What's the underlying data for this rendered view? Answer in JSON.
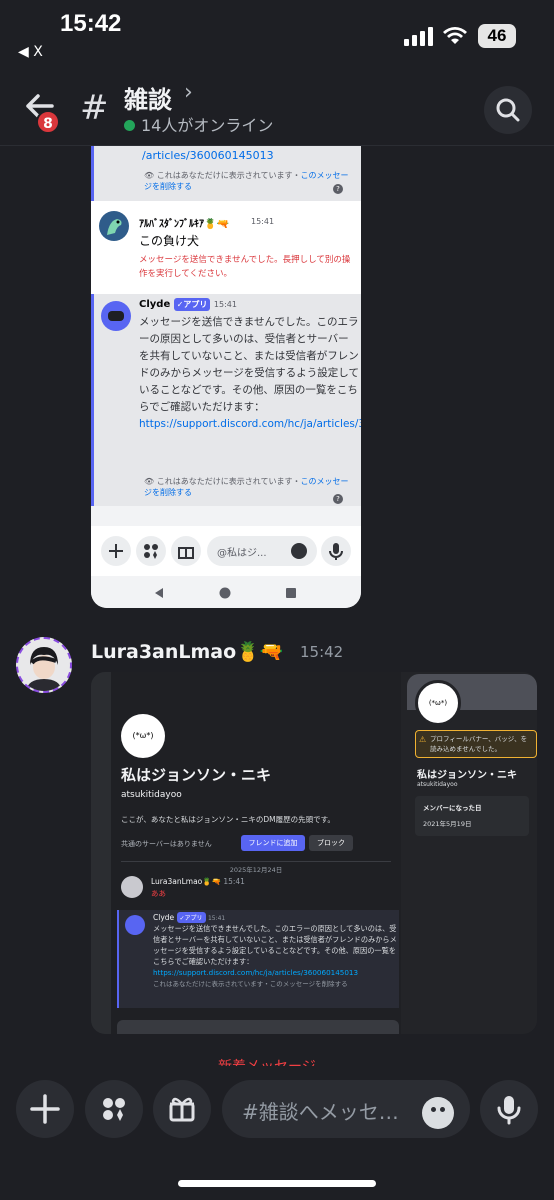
{
  "status_bar": {
    "time": "15:42",
    "back_app": "◀ X",
    "battery": "46"
  },
  "header": {
    "badge": "8",
    "channel_hash": "#",
    "channel_name": "雑談",
    "chevron": "›",
    "online_text": "14人がオンライン"
  },
  "screenshot1": {
    "top_link": "/articles/360060145013",
    "ephemeral_text": "これはあなただけに表示されています・",
    "ephemeral_link": "このメッセージを削除する",
    "msg1": {
      "author": "ｱﾙﾊﾞｽﾀﾞﾝﾌﾞﾙｷｱ🍍🔫",
      "time": "15:41",
      "text": "この負け犬",
      "error": "メッセージを送信できませんでした。長押しして別の操作を実行してください。"
    },
    "msg2": {
      "author": "Clyde",
      "app_tag": "✓アプリ",
      "time": "15:41",
      "body": "メッセージを送信できませんでした。このエラーの原因として多いのは、受信者とサーバーを共有していないこと、または受信者がフレンドのみからメッセージを受信するよう設定していることなどです。その他、原因の一覧をこちらでご確認いただけます：",
      "link": "https://support.discord.com/hc/ja/articles/360060145013"
    },
    "input_placeholder": "@私はジ..."
  },
  "message": {
    "author": "Lura3anLmao🍍🔫",
    "time": "15:42"
  },
  "screenshot2": {
    "avatar_face": "(*ω*)",
    "profile_title": "私はジョンソン・ニキ",
    "username": "atsukitidayoo",
    "dm_desc": "ここが、あなたと私はジョンソン・ニキのDM履歴の先頭です。",
    "common_servers": "共通のサーバーはありません",
    "add_friend": "フレンドに追加",
    "block": "ブロック",
    "date_divider": "2025年12月24日",
    "msg_author": "Lura3anLmao🍍🔫",
    "msg_time": "15:41",
    "msg_text": "ああ",
    "clyde_name": "Clyde",
    "clyde_tag": "✓アプリ",
    "clyde_time": "15:41",
    "clyde_body": "メッセージを送信できませんでした。このエラーの原因として多いのは、受信者とサーバーを共有していないこと、または受信者がフレンドのみからメッセージを受信するよう設定していることなどです。その他、原因の一覧をこちらでご確認いただけます：",
    "clyde_link": "https://support.discord.com/hc/ja/articles/360060145013",
    "ephemeral": "これはあなただけに表示されています・このメッセージを削除する",
    "warning": "プロフィールバナー、バッジ、を読み込めませんでした。",
    "member_since_label": "メンバーになった日",
    "member_since": "2021年5月19日"
  },
  "new_messages": "新着メッセージ",
  "composer": {
    "placeholder": "#雑談へメッセ…"
  }
}
